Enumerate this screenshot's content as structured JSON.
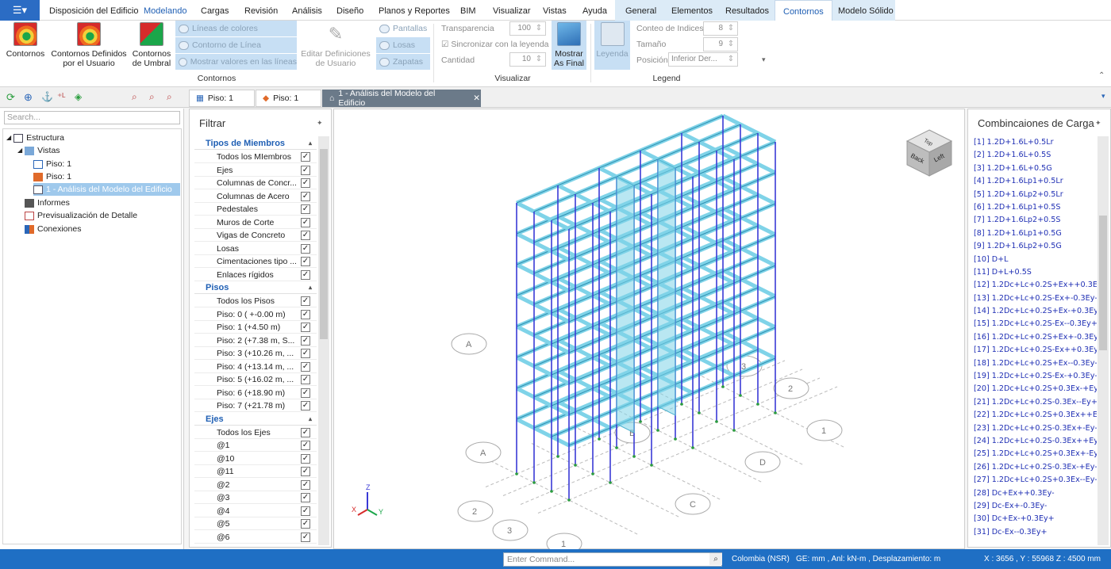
{
  "menu": {
    "tabs": [
      "Disposición del Edificio",
      "Modelando",
      "Cargas",
      "Revisión",
      "Análisis",
      "Diseño",
      "Planos y Reportes",
      "BIM",
      "Visualizar",
      "Vistas",
      "Ayuda"
    ],
    "context_tabs": [
      "General",
      "Elementos",
      "Resultados",
      "Contornos",
      "Modelo Sólido"
    ]
  },
  "ribbon": {
    "contornos_btn": "Contornos",
    "definidos_btn": "Contornos Definidos por el Usuario",
    "umbral_btn": "Contornos de Umbral",
    "lineas_colores": "Líneas de colores",
    "contorno_linea": "Contorno de Línea",
    "mostrar_valores": "Mostrar valores en las líneas",
    "editar_def": "Editar Definiciones de Usuario",
    "pantallas": "Pantallas",
    "losas": "Losas",
    "zapatas": "Zapatas",
    "group_contornos": "Contornos",
    "transparencia_label": "Transparencia",
    "transparencia_value": "100",
    "sincronizar": "Sincronizar con la leyenda",
    "cantidad_label": "Cantidad",
    "cantidad_value": "10",
    "mostrar_final": "Mostrar As Final",
    "group_visualizar": "Visualizar",
    "leyenda_btn": "Leyenda",
    "conteo_label": "Conteo de Indices",
    "conteo_value": "8",
    "tamano_label": "Tamaño",
    "tamano_value": "9",
    "posicion_label": "Posición",
    "posicion_value": "Inferior Der...",
    "group_leyenda": "Legend"
  },
  "doc_tabs": [
    "Piso: 1",
    "Piso: 1",
    "1 - Análisis del Modelo del Edificio"
  ],
  "tree": {
    "search_placeholder": "Search...",
    "estructura": "Estructura",
    "vistas": "Vistas",
    "piso1a": "Piso: 1",
    "piso1b": "Piso: 1",
    "analisis": "1 - Análisis del Modelo del Edificio",
    "informes": "Informes",
    "previsualizacion": "Previsualización de Detalle",
    "conexiones": "Conexiones"
  },
  "filter": {
    "title": "Filtrar",
    "sec_miembros": "Tipos de Miembros",
    "miembros": [
      "Todos los MIembros",
      "Ejes",
      "Columnas de Concr...",
      "Columnas de Acero",
      "Pedestales",
      "Muros de Corte",
      "Vigas de Concreto",
      "Losas",
      "Cimentaciones tipo ...",
      "Enlaces rígidos"
    ],
    "sec_pisos": "Pisos",
    "pisos": [
      "Todos los Pisos",
      "Piso: 0 ( +-0.00 m)",
      "Piso: 1 (+4.50 m)",
      "Piso: 2 (+7.38 m, S...",
      "Piso: 3 (+10.26 m, ...",
      "Piso: 4 (+13.14 m, ...",
      "Piso: 5 (+16.02 m, ...",
      "Piso: 6 (+18.90 m)",
      "Piso: 7 (+21.78 m)"
    ],
    "sec_ejes": "Ejes",
    "ejes": [
      "Todos los Ejes",
      "@1",
      "@10",
      "@11",
      "@2",
      "@3",
      "@4",
      "@5",
      "@6"
    ]
  },
  "viewcube": {
    "back": "Back",
    "left": "Left",
    "top": "Top"
  },
  "axis_labels": {
    "z": "Z",
    "x": "X",
    "y": "Y"
  },
  "grid_bubbles": [
    "A",
    "A",
    "B",
    "C",
    "D",
    "1",
    "2",
    "3",
    "2",
    "3",
    "1"
  ],
  "combinations": {
    "title": "Combincaiones de Carga",
    "items": [
      "[1] 1.2D+1.6L+0.5Lr",
      "[2] 1.2D+1.6L+0.5S",
      "[3] 1.2D+1.6L+0.5G",
      "[4] 1.2D+1.6Lp1+0.5Lr",
      "[5] 1.2D+1.6Lp2+0.5Lr",
      "[6] 1.2D+1.6Lp1+0.5S",
      "[7] 1.2D+1.6Lp2+0.5S",
      "[8] 1.2D+1.6Lp1+0.5G",
      "[9] 1.2D+1.6Lp2+0.5G",
      "[10] D+L",
      "[11] D+L+0.5S",
      "[12] 1.2Dc+Lc+0.2S+Ex++0.3Ey-",
      "[13] 1.2Dc+Lc+0.2S-Ex+-0.3Ey-",
      "[14] 1.2Dc+Lc+0.2S+Ex-+0.3Ey+",
      "[15] 1.2Dc+Lc+0.2S-Ex--0.3Ey+",
      "[16] 1.2Dc+Lc+0.2S+Ex+-0.3Ey+",
      "[17] 1.2Dc+Lc+0.2S-Ex++0.3Ey+",
      "[18] 1.2Dc+Lc+0.2S+Ex--0.3Ey-",
      "[19] 1.2Dc+Lc+0.2S-Ex-+0.3Ey-",
      "[20] 1.2Dc+Lc+0.2S+0.3Ex-+Ey+",
      "[21] 1.2Dc+Lc+0.2S-0.3Ex--Ey+",
      "[22] 1.2Dc+Lc+0.2S+0.3Ex++Ey-",
      "[23] 1.2Dc+Lc+0.2S-0.3Ex+-Ey-",
      "[24] 1.2Dc+Lc+0.2S-0.3Ex++Ey+",
      "[25] 1.2Dc+Lc+0.2S+0.3Ex+-Ey+",
      "[26] 1.2Dc+Lc+0.2S-0.3Ex-+Ey-",
      "[27] 1.2Dc+Lc+0.2S+0.3Ex--Ey-",
      "[28] Dc+Ex++0.3Ey-",
      "[29] Dc-Ex+-0.3Ey-",
      "[30] Dc+Ex-+0.3Ey+",
      "[31] Dc-Ex--0.3Ey+"
    ]
  },
  "status": {
    "command_placeholder": "Enter Command...",
    "code": "Colombia (NSR)",
    "units": "GE: mm , Anl: kN-m , Desplazamiento: m",
    "coords": "X : 3656 , Y : 55968   Z : 4500 mm"
  },
  "colors": {
    "accent": "#1f6fc4",
    "member": "#7fd3e8",
    "column": "#3a3ad6"
  }
}
